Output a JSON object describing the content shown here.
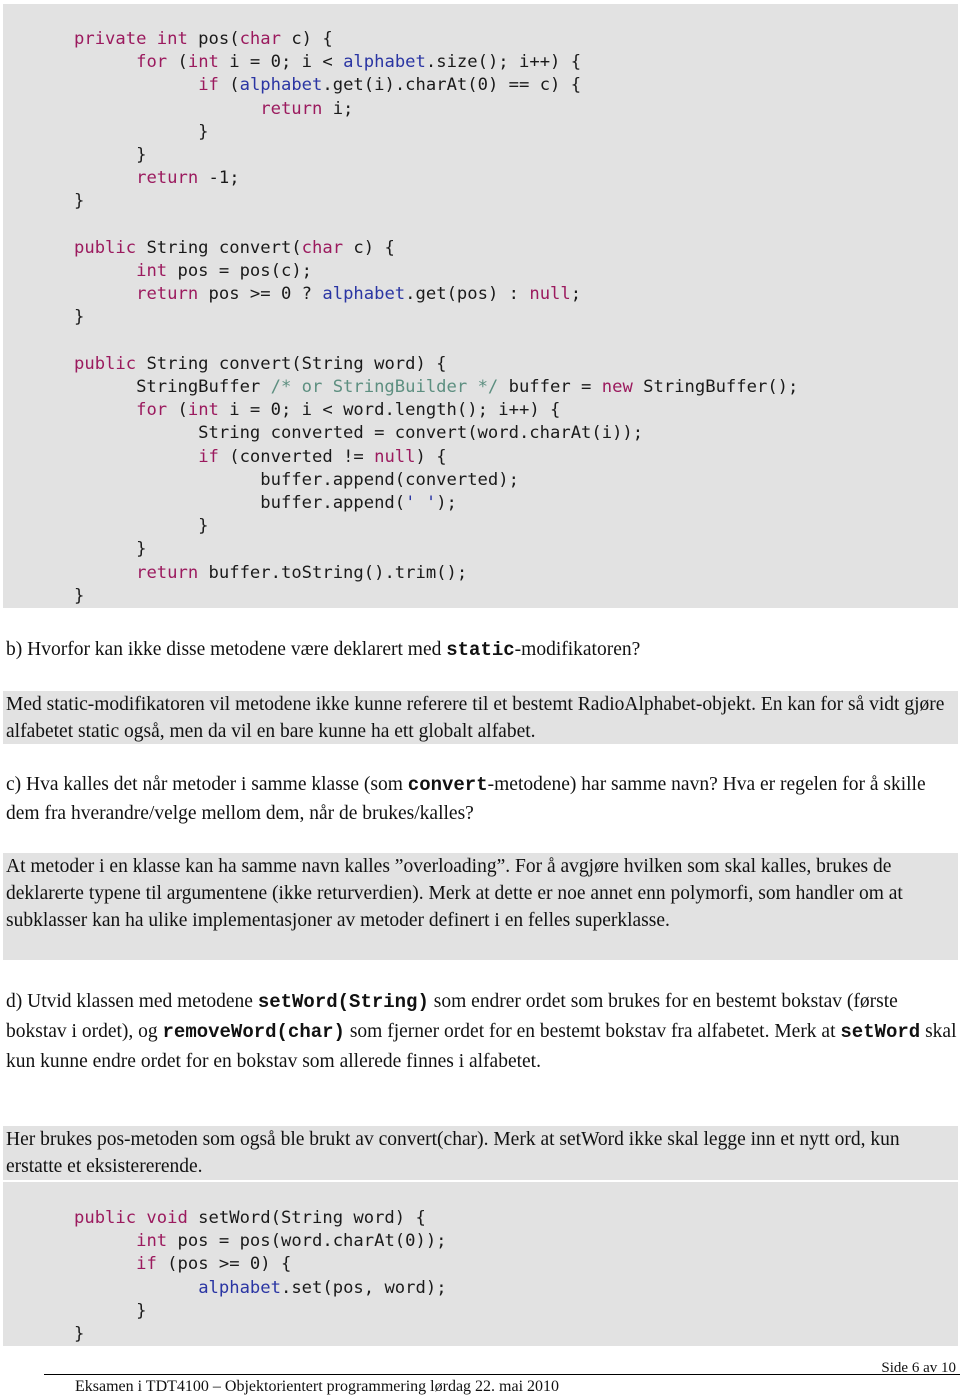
{
  "code_block_1": {
    "lines": [
      [
        {
          "t": "private int",
          "c": "kw"
        },
        {
          "t": " pos("
        },
        {
          "t": "char",
          "c": "kw"
        },
        {
          "t": " c) {"
        }
      ],
      [
        {
          "t": "      "
        },
        {
          "t": "for",
          "c": "kw"
        },
        {
          "t": " ("
        },
        {
          "t": "int",
          "c": "kw"
        },
        {
          "t": " i = 0; i < "
        },
        {
          "t": "alphabet",
          "c": "fld"
        },
        {
          "t": ".size(); i++) {"
        }
      ],
      [
        {
          "t": "            "
        },
        {
          "t": "if",
          "c": "kw"
        },
        {
          "t": " ("
        },
        {
          "t": "alphabet",
          "c": "fld"
        },
        {
          "t": ".get(i).charAt(0) == c) {"
        }
      ],
      [
        {
          "t": "                  "
        },
        {
          "t": "return",
          "c": "kw"
        },
        {
          "t": " i;"
        }
      ],
      [
        {
          "t": "            }"
        }
      ],
      [
        {
          "t": "      }"
        }
      ],
      [
        {
          "t": "      "
        },
        {
          "t": "return",
          "c": "kw"
        },
        {
          "t": " -1;"
        }
      ],
      [
        {
          "t": "}"
        }
      ],
      [
        {
          "t": ""
        }
      ],
      [
        {
          "t": "public",
          "c": "kw"
        },
        {
          "t": " String convert("
        },
        {
          "t": "char",
          "c": "kw"
        },
        {
          "t": " c) {"
        }
      ],
      [
        {
          "t": "      "
        },
        {
          "t": "int",
          "c": "kw"
        },
        {
          "t": " pos = pos(c);"
        }
      ],
      [
        {
          "t": "      "
        },
        {
          "t": "return",
          "c": "kw"
        },
        {
          "t": " pos >= 0 ? "
        },
        {
          "t": "alphabet",
          "c": "fld"
        },
        {
          "t": ".get(pos) : "
        },
        {
          "t": "null",
          "c": "kw"
        },
        {
          "t": ";"
        }
      ],
      [
        {
          "t": "}"
        }
      ],
      [
        {
          "t": ""
        }
      ],
      [
        {
          "t": "public",
          "c": "kw"
        },
        {
          "t": " String convert(String word) {"
        }
      ],
      [
        {
          "t": "      StringBuffer "
        },
        {
          "t": "/* or StringBuilder */",
          "c": "cm"
        },
        {
          "t": " buffer = "
        },
        {
          "t": "new",
          "c": "kw"
        },
        {
          "t": " StringBuffer();"
        }
      ],
      [
        {
          "t": "      "
        },
        {
          "t": "for",
          "c": "kw"
        },
        {
          "t": " ("
        },
        {
          "t": "int",
          "c": "kw"
        },
        {
          "t": " i = 0; i < word.length(); i++) {"
        }
      ],
      [
        {
          "t": "            String converted = convert(word.charAt(i));"
        }
      ],
      [
        {
          "t": "            "
        },
        {
          "t": "if",
          "c": "kw"
        },
        {
          "t": " (converted != "
        },
        {
          "t": "null",
          "c": "kw"
        },
        {
          "t": ") {"
        }
      ],
      [
        {
          "t": "                  buffer.append(converted);"
        }
      ],
      [
        {
          "t": "                  buffer.append("
        },
        {
          "t": "' '",
          "c": "str"
        },
        {
          "t": ");"
        }
      ],
      [
        {
          "t": "            }"
        }
      ],
      [
        {
          "t": "      }"
        }
      ],
      [
        {
          "t": "      "
        },
        {
          "t": "return",
          "c": "kw"
        },
        {
          "t": " buffer.toString().trim();"
        }
      ],
      [
        {
          "t": "}"
        }
      ]
    ]
  },
  "question_b": {
    "prefix": "b) Hvorfor kan ikke disse metodene være deklarert med ",
    "code": "static",
    "suffix": "-modifikatoren?"
  },
  "answer_b": {
    "text": "Med static-modifikatoren vil metodene ikke kunne referere til et bestemt RadioAlphabet-objekt. En kan for så vidt gjøre alfabetet static også, men da vil en bare kunne ha ett globalt alfabet."
  },
  "question_c": {
    "prefix": "c) Hva kalles det når metoder i samme klasse (som ",
    "code": "convert",
    "suffix": "-metodene) har samme navn? Hva er regelen for å skille dem fra hverandre/velge mellom dem, når de brukes/kalles?"
  },
  "answer_c": {
    "text": "At metoder i en klasse kan ha samme navn kalles ”overloading”. For å avgjøre hvilken som skal kalles, brukes de deklarerte typene til argumentene (ikke returverdien). Merk at dette er noe annet enn polymorfi, som handler om at subklasser kan ha ulike implementasjoner av metoder definert i en felles superklasse."
  },
  "question_d": {
    "part1": "d) Utvid klassen med metodene ",
    "code1": "setWord(String)",
    "part2": " som endrer ordet som brukes for en bestemt bokstav (første bokstav i ordet), og ",
    "code2": "removeWord(char)",
    "part3": " som fjerner ordet for en bestemt bokstav fra alfabetet. Merk at ",
    "code3": "setWord",
    "part4": " skal kun kunne endre ordet for en bokstav som allerede finnes i alfabetet."
  },
  "answer_d": {
    "text": "Her brukes pos-metoden som også ble brukt av convert(char). Merk at setWord ikke skal legge inn et nytt ord, kun erstatte et eksistererende."
  },
  "code_block_2": {
    "lines": [
      [
        {
          "t": "public void",
          "c": "kw"
        },
        {
          "t": " setWord(String word) {"
        }
      ],
      [
        {
          "t": "      "
        },
        {
          "t": "int",
          "c": "kw"
        },
        {
          "t": " pos = pos(word.charAt(0));"
        }
      ],
      [
        {
          "t": "      "
        },
        {
          "t": "if",
          "c": "kw"
        },
        {
          "t": " (pos >= 0) {"
        }
      ],
      [
        {
          "t": "            "
        },
        {
          "t": "alphabet",
          "c": "fld"
        },
        {
          "t": ".set(pos, word);"
        }
      ],
      [
        {
          "t": "      }"
        }
      ],
      [
        {
          "t": "}"
        }
      ]
    ]
  },
  "footer": {
    "page": "Side 6 av 10",
    "title": "Eksamen i TDT4100 – Objektorientert programmering lørdag 22. mai 2010"
  }
}
